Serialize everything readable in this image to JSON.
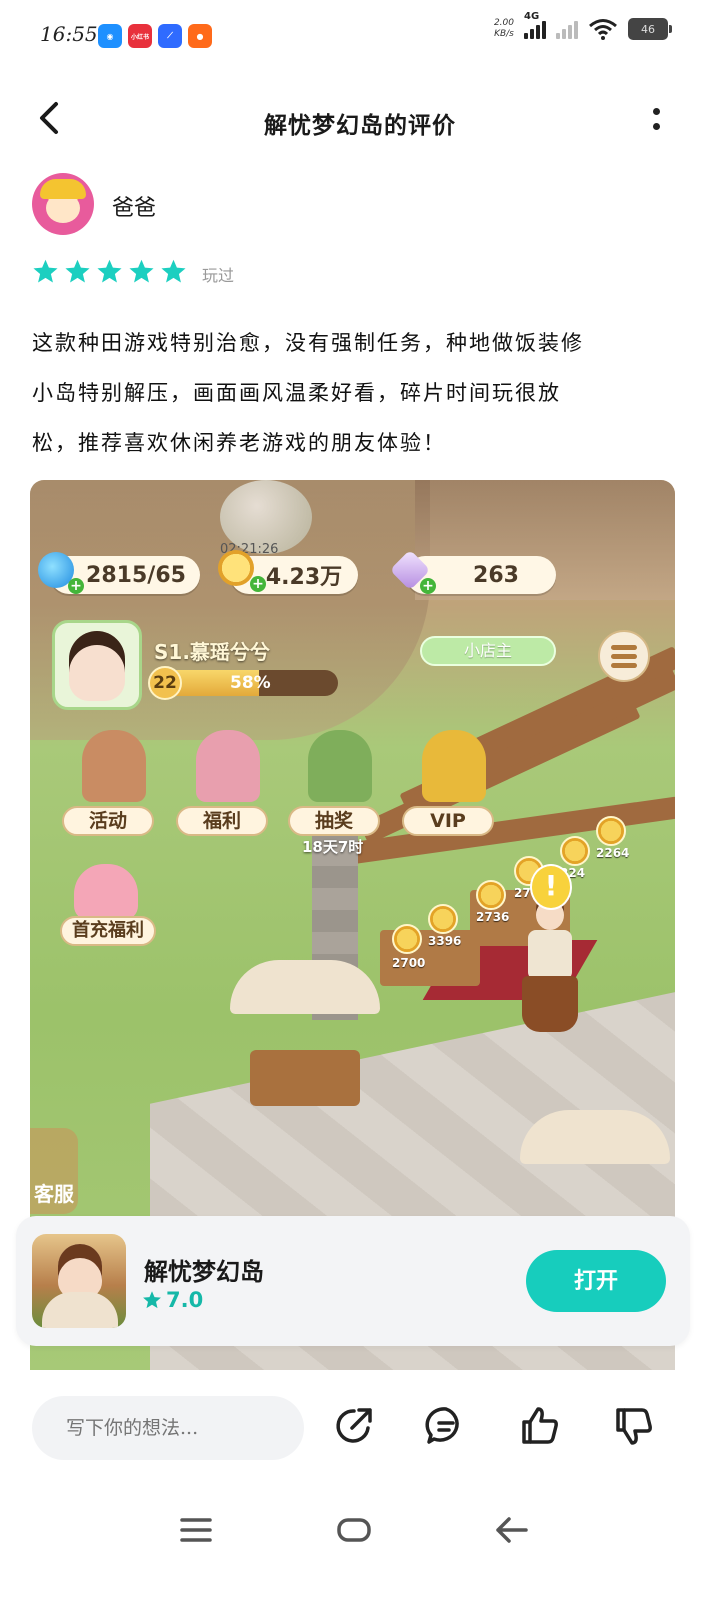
{
  "status_bar": {
    "time": "16:55",
    "net_speed_value": "2.00",
    "net_speed_unit": "KB/s",
    "network_type": "4G",
    "battery": "46",
    "app_icons": [
      {
        "name": "soul-app-icon",
        "color": "#1e90ff",
        "label": ""
      },
      {
        "name": "xiaohongshu-icon",
        "color": "#e8313c",
        "label": "小红书"
      },
      {
        "name": "blue-app-icon",
        "color": "#2f6bff",
        "label": ""
      },
      {
        "name": "kuaishou-icon",
        "color": "#ff6a1a",
        "label": ""
      }
    ]
  },
  "header": {
    "title": "解忧梦幻岛的评价"
  },
  "review": {
    "username": "爸爸",
    "rating": 5,
    "played_tag": "玩过",
    "text_lines": [
      "这款种田游戏特别治愈，没有强制任务，种地做饭装修",
      "小岛特别解压，画面画风温柔好看，碎片时间玩很放",
      "松，推荐喜欢休闲养老游戏的朋友体验！"
    ]
  },
  "game_screenshot": {
    "water": "2815/65",
    "coins": "4.23万",
    "diamonds": "263",
    "timer": "02:21:26",
    "player_name": "S1.慕瑶兮兮",
    "level": "22",
    "level_progress_text": "58%",
    "level_progress": 0.58,
    "shop_badge": "小店主",
    "features": [
      {
        "label": "活动",
        "color": "#c98c63"
      },
      {
        "label": "福利",
        "color": "#e89fae"
      },
      {
        "label": "抽奖",
        "color": "#7fae5b"
      },
      {
        "label": "VIP",
        "color": "#e8b93a"
      }
    ],
    "draw_countdown": "18天7时",
    "first_charge": "首充福利",
    "coin_values": [
      "2700",
      "3396",
      "2736",
      "27",
      "224",
      "2264"
    ],
    "service_label": "客服"
  },
  "app_card": {
    "name": "解忧梦幻岛",
    "score": "7.0",
    "open_label": "打开"
  },
  "toolbar": {
    "comment_placeholder": "写下你的想法..."
  },
  "colors": {
    "accent": "#17cdbd",
    "star": "#1ccfc0"
  }
}
